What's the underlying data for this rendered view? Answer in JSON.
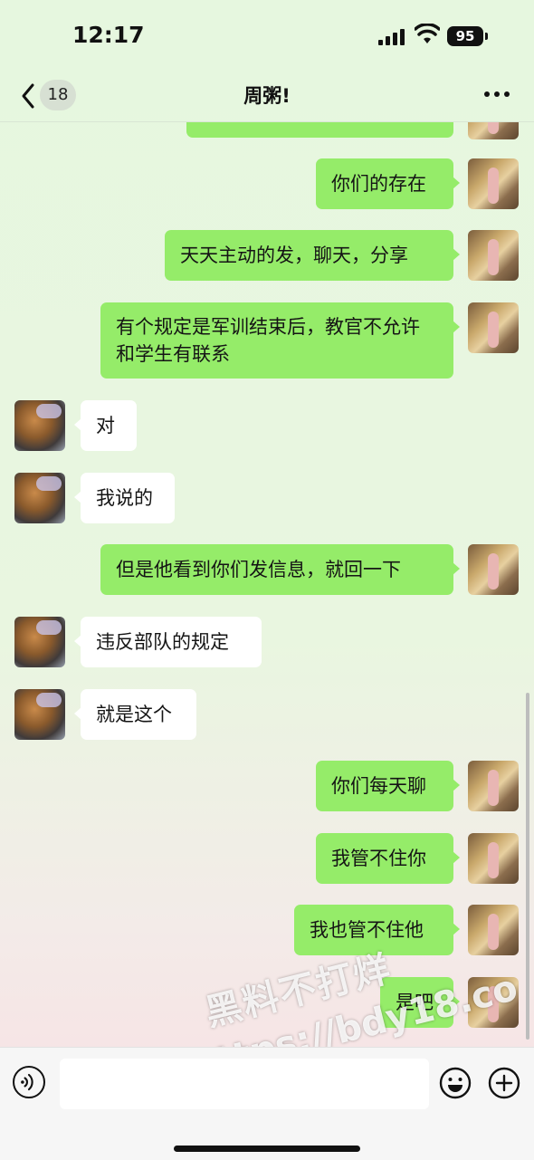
{
  "status_bar": {
    "time": "12:17",
    "battery": "95"
  },
  "nav": {
    "unread_count": "18",
    "title": "周粥!"
  },
  "messages": [
    {
      "sender": "me",
      "text": ""
    },
    {
      "sender": "me",
      "text": "你们的存在"
    },
    {
      "sender": "me",
      "text": "天天主动的发，聊天，分享"
    },
    {
      "sender": "me",
      "text": "有个规定是军训结束后，教官不允许和学生有联系"
    },
    {
      "sender": "them",
      "text": "对"
    },
    {
      "sender": "them",
      "text": "我说的"
    },
    {
      "sender": "me",
      "text": "但是他看到你们发信息，就回一下"
    },
    {
      "sender": "them",
      "text": "违反部队的规定"
    },
    {
      "sender": "them",
      "text": "就是这个"
    },
    {
      "sender": "me",
      "text": "你们每天聊"
    },
    {
      "sender": "me",
      "text": "我管不住你"
    },
    {
      "sender": "me",
      "text": "我也管不住他"
    },
    {
      "sender": "me",
      "text": "是吧"
    }
  ],
  "watermark": {
    "line1": "黑料不打烊",
    "line2": "https://bdy18.co"
  },
  "input": {
    "value": ""
  },
  "icons": {
    "back": "chevron-left-icon",
    "more": "more-dots-icon",
    "voice": "voice-icon",
    "emoji": "emoji-icon",
    "plus": "plus-icon"
  }
}
